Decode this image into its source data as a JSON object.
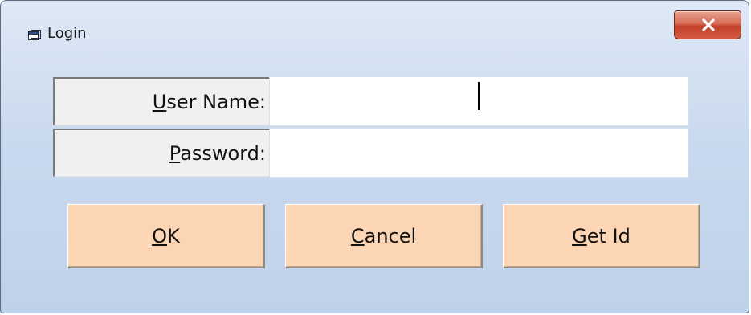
{
  "window": {
    "title": "Login",
    "close_glyph": "X"
  },
  "form": {
    "username_label_mnemonic": "U",
    "username_label_rest": "ser Name:",
    "username_value": "",
    "password_label_mnemonic": "P",
    "password_label_rest": "assword:",
    "password_value": ""
  },
  "buttons": {
    "ok_mnemonic": "O",
    "ok_rest": "K",
    "cancel_mnemonic": "C",
    "cancel_rest": "ancel",
    "getid_mnemonic": "G",
    "getid_rest": "et Id"
  },
  "icons": {
    "app": "window-icon",
    "close": "close-icon"
  },
  "colors": {
    "button_face": "#fcd6b4",
    "close_button": "#c2402a",
    "titlebar": "#c9d9ee"
  }
}
